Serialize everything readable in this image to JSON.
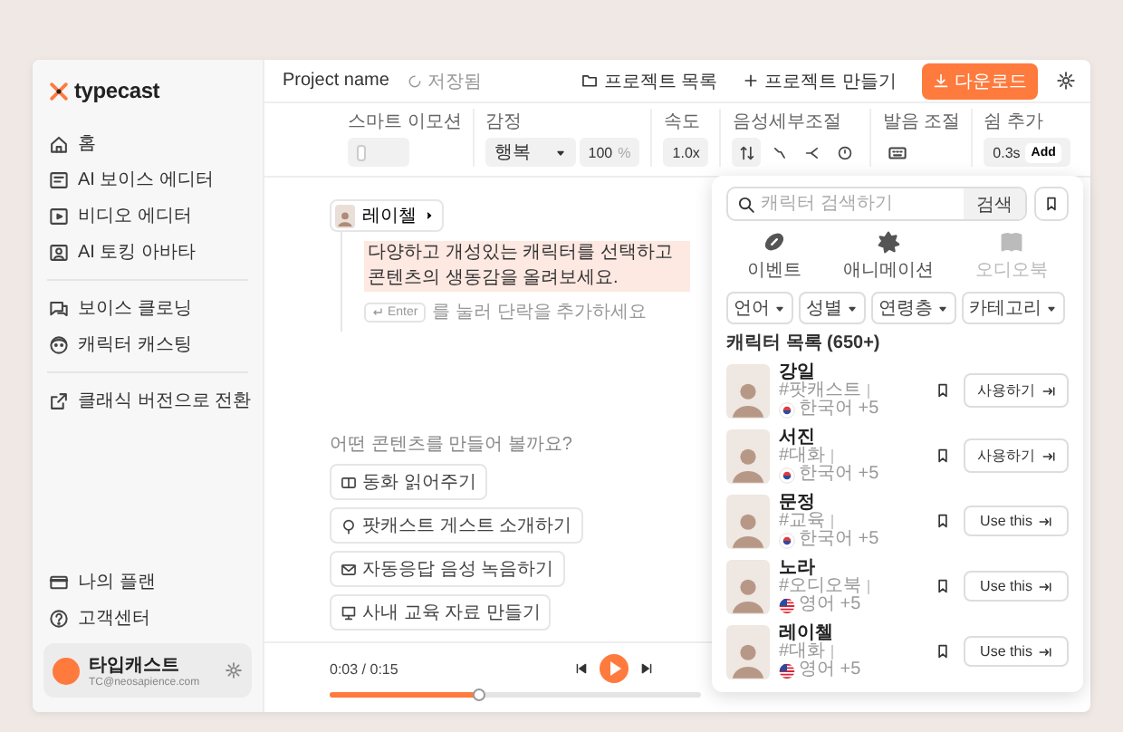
{
  "logo": {
    "text": "typecast"
  },
  "sidebar": {
    "sections": [
      {
        "items": [
          "홈",
          "AI 보이스 에디터",
          "비디오 에디터",
          "AI 토킹 아바타"
        ]
      },
      {
        "items": [
          "보이스 클로닝",
          "캐릭터 캐스팅"
        ]
      },
      {
        "items": [
          "클래식 버전으로 전환"
        ]
      }
    ],
    "bottom_items": [
      "나의 플랜",
      "고객센터"
    ],
    "user": {
      "name": "타입캐스트",
      "email": "TC@neosapience.com"
    }
  },
  "header": {
    "project_name": "Project name",
    "save_status": "저장됨",
    "buttons": [
      "프로젝트 목록",
      "프로젝트 만들기"
    ],
    "download": "다운로드"
  },
  "toolbar": {
    "smart_emotion": {
      "label": "스마트 이모션",
      "on": false
    },
    "emotion": {
      "label": "감정",
      "value": "행복",
      "intensity": "100",
      "unit": "%"
    },
    "speed": {
      "label": "속도",
      "value": "1.0x"
    },
    "voice_detail": {
      "label": "음성세부조절"
    },
    "pronunciation": {
      "label": "발음 조절"
    },
    "pause": {
      "label": "쉼 추가",
      "value": "0.3s",
      "button": "Add"
    }
  },
  "editor": {
    "speaker": "레이첼",
    "paragraph": "다양하고 개성있는 캐릭터를 선택하고 콘텐츠의 생동감을 올려보세요.",
    "enter_key": "Enter",
    "hint": "를 눌러 단락을 추가하세요"
  },
  "suggestions": {
    "title": "어떤 콘텐츠를 만들어 볼까요?",
    "chips": [
      "동화 읽어주기",
      "팟캐스트 게스트 소개하기",
      "자동응답 음성 녹음하기",
      "사내 교육 자료 만들기"
    ]
  },
  "player": {
    "time": "0:03 / 0:15",
    "level": 0.4
  },
  "panel": {
    "search_placeholder": "캐릭터 검색하기",
    "search_button": "검색",
    "categories": [
      {
        "label": "이벤트",
        "disabled": false
      },
      {
        "label": "애니메이션",
        "disabled": false
      },
      {
        "label": "오디오북",
        "disabled": true
      }
    ],
    "filters": [
      "언어",
      "성별",
      "연령층",
      "카테고리"
    ],
    "list_title": "캐릭터 목록 (650+)",
    "characters": [
      {
        "name": "강일",
        "tag": "#팟캐스트",
        "kind": "kr",
        "language": "한국어 +5",
        "button": "사용하기"
      },
      {
        "name": "서진",
        "tag": "#대화",
        "kind": "kr",
        "language": "한국어 +5",
        "button": "사용하기"
      },
      {
        "name": "문정",
        "tag": "#교육",
        "kind": "kr",
        "language": "한국어 +5",
        "button": "Use this"
      },
      {
        "name": "노라",
        "tag": "#오디오북",
        "kind": "us",
        "language": "영어 +5",
        "button": "Use this"
      },
      {
        "name": "레이첼",
        "tag": "#대화",
        "kind": "us",
        "language": "영어 +5",
        "button": "Use this"
      }
    ]
  }
}
